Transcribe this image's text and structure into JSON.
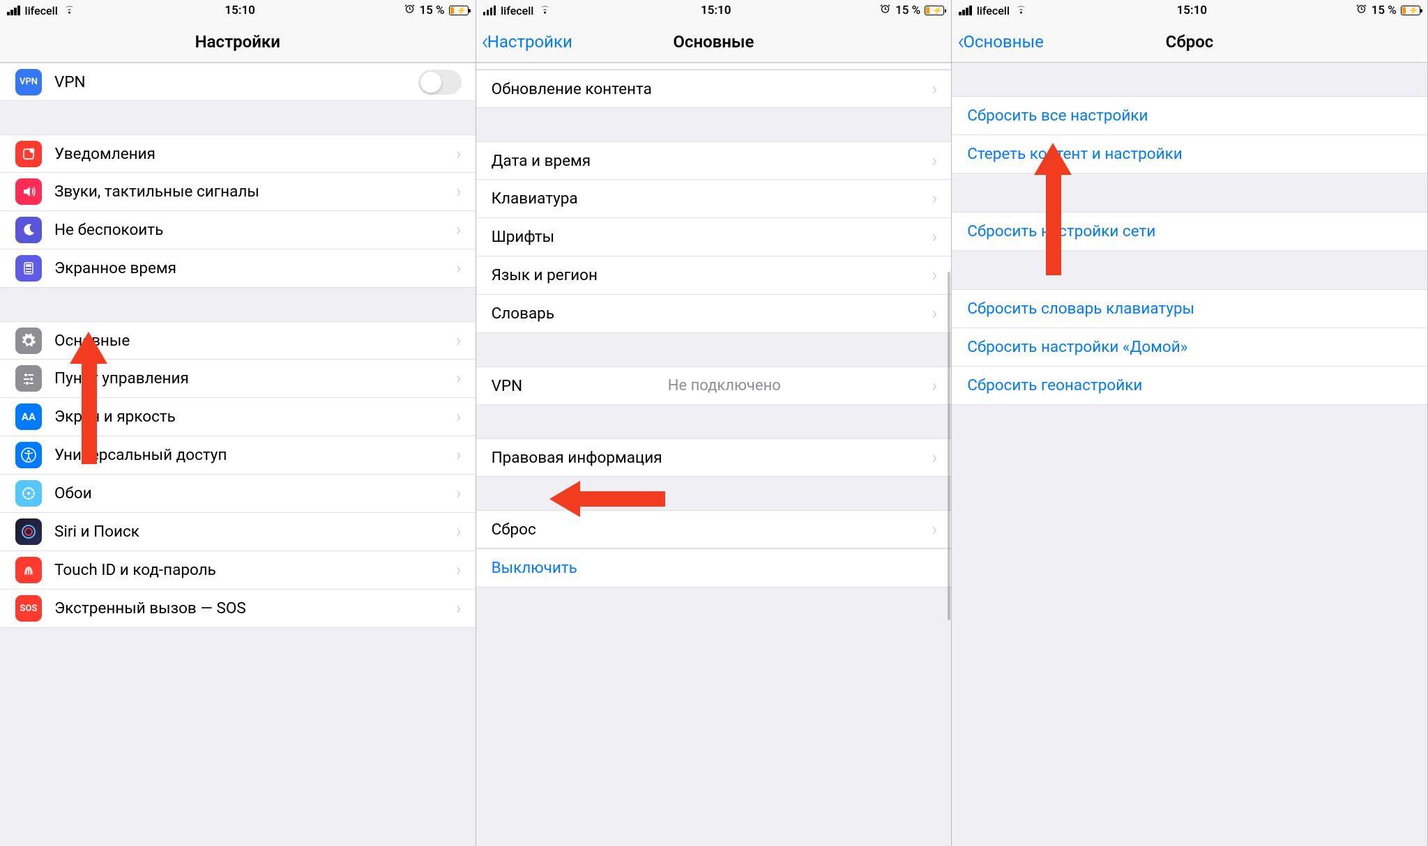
{
  "status": {
    "carrier": "lifecell",
    "time": "15:10",
    "battery_pct": "15 %"
  },
  "screen1": {
    "title": "Настройки",
    "rows": {
      "vpn": "VPN",
      "notifications": "Уведомления",
      "sounds": "Звуки, тактильные сигналы",
      "dnd": "Не беспокоить",
      "screentime": "Экранное время",
      "general": "Основные",
      "control_center": "Пункт управления",
      "display": "Экран и яркость",
      "accessibility": "Универсальный доступ",
      "wallpaper": "Обои",
      "siri": "Siri и Поиск",
      "touchid": "Touch ID и код-пароль",
      "sos": "Экстренный вызов — SOS"
    }
  },
  "screen2": {
    "back": "Настройки",
    "title": "Основные",
    "rows": {
      "background_refresh": "Обновление контента",
      "datetime": "Дата и время",
      "keyboard": "Клавиатура",
      "fonts": "Шрифты",
      "language": "Язык и регион",
      "dictionary": "Словарь",
      "vpn": "VPN",
      "vpn_detail": "Не подключено",
      "legal": "Правовая информация",
      "reset": "Сброс",
      "shutdown": "Выключить"
    }
  },
  "screen3": {
    "back": "Основные",
    "title": "Сброс",
    "rows": {
      "reset_all": "Сбросить все настройки",
      "erase_all": "Стереть контент и настройки",
      "reset_network": "Сбросить настройки сети",
      "reset_keyboard": "Сбросить словарь клавиатуры",
      "reset_home": "Сбросить настройки «Домой»",
      "reset_location": "Сбросить геонастройки"
    }
  },
  "icons": {
    "vpn": "VPN",
    "aa": "AA",
    "sos": "SOS"
  },
  "colors": {
    "blue": "#007AFF",
    "red": "#FF3B30",
    "purple": "#5856D6",
    "indigo": "#5E5CE6",
    "green": "#34C759",
    "gray": "#8E8E93",
    "teal": "#32ADE6",
    "orange": "#FF9500"
  }
}
